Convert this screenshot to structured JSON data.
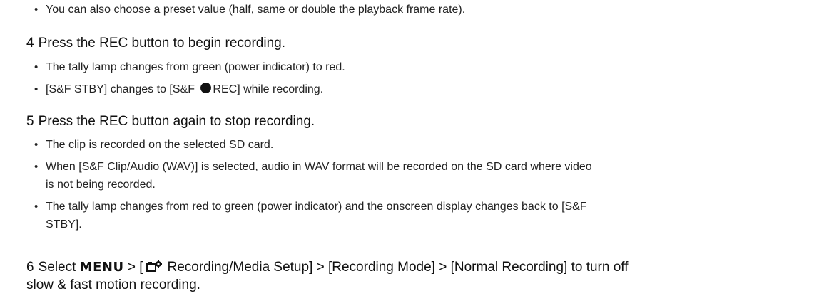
{
  "lines": {
    "preset_note": "You can also choose a preset value (half, same or double the playback frame rate).",
    "step4": {
      "num": "4",
      "text": "Press the REC button to begin recording."
    },
    "step4_b1": "The tally lamp changes from green (power indicator) to red.",
    "step4_b2_a": "[S&F STBY] changes to [S&F ",
    "step4_b2_b": "REC] while recording.",
    "step5": {
      "num": "5",
      "text": "Press the REC button again to stop recording."
    },
    "step5_b1": "The clip is recorded on the selected SD card.",
    "step5_b2_l1": "When [S&F Clip/Audio (WAV)] is selected, audio in WAV format will be recorded on the SD card where video",
    "step5_b2_l2": "is not being recorded.",
    "step5_b3_l1": "The tally lamp changes from red to green (power indicator) and the onscreen display changes back to [S&F",
    "step5_b3_l2": "STBY].",
    "step6": {
      "num": "6",
      "select": "Select",
      "menu": "MENU",
      "after_menu": "> [",
      "rest_l1": "Recording/Media Setup] > [Recording Mode] > [Normal Recording] to turn off",
      "l2": "slow & fast motion recording."
    }
  },
  "icons": {
    "bullet": "bullet-dot",
    "record": "record-dot-icon",
    "camera_settings": "camera-settings-icon"
  }
}
